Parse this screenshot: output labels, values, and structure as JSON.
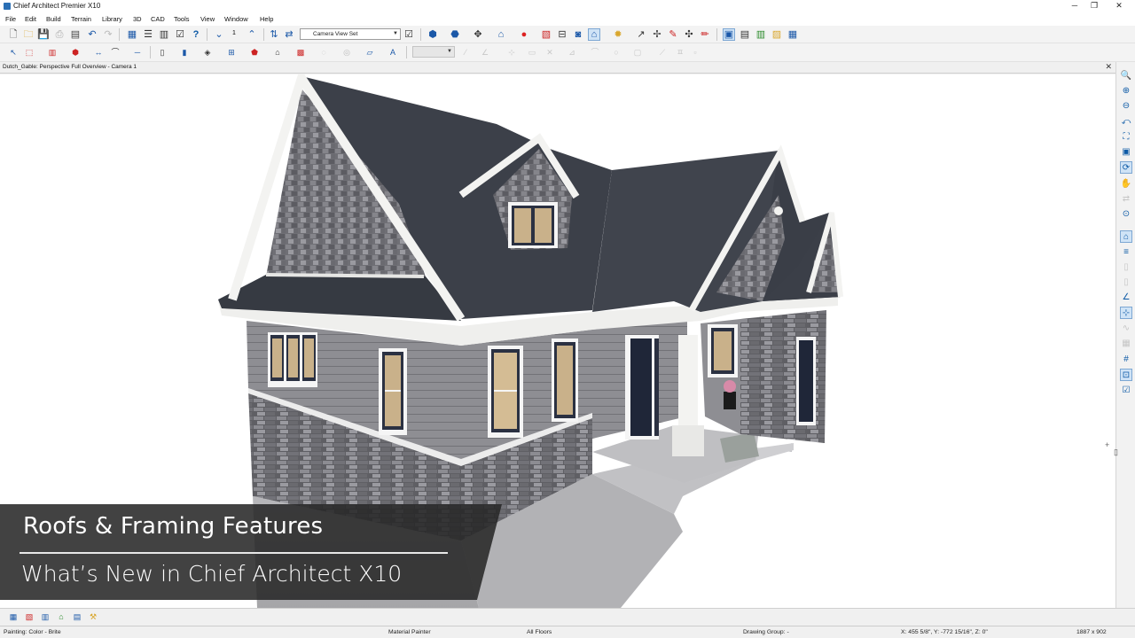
{
  "window": {
    "title": "Chief Architect Premier X10",
    "controls": {
      "minimize": "─",
      "maximize": "❐",
      "close": "✕"
    }
  },
  "menu": [
    "File",
    "Edit",
    "Build",
    "Terrain",
    "Library",
    "3D",
    "CAD",
    "Tools",
    "View",
    "Window",
    "Help"
  ],
  "toolbar1": {
    "page_number": "1",
    "camera_view_set": "Camera View Set"
  },
  "document": {
    "tab_title": "Dutch_Gable: Perspective Full Overview - Camera 1",
    "close": "✕"
  },
  "caption": {
    "heading": "Roofs & Framing Features",
    "subheading": "What’s New in Chief Architect X10"
  },
  "status": {
    "painting": "Painting: Color - Brite",
    "tool": "Material Painter",
    "floors": "All Floors",
    "drawing_group": "Drawing Group: -",
    "coordinates": "X: 455 5/8\", Y: -772 15/16\", Z: 0\"",
    "size": "1887 x 902"
  },
  "colors": {
    "accent_blue": "#0d5aa6",
    "roof": "#3c4049",
    "siding": "#8e8e92",
    "stone": "#6b6b70",
    "trim": "#f2f2f0",
    "caption_bg": "#282828"
  }
}
